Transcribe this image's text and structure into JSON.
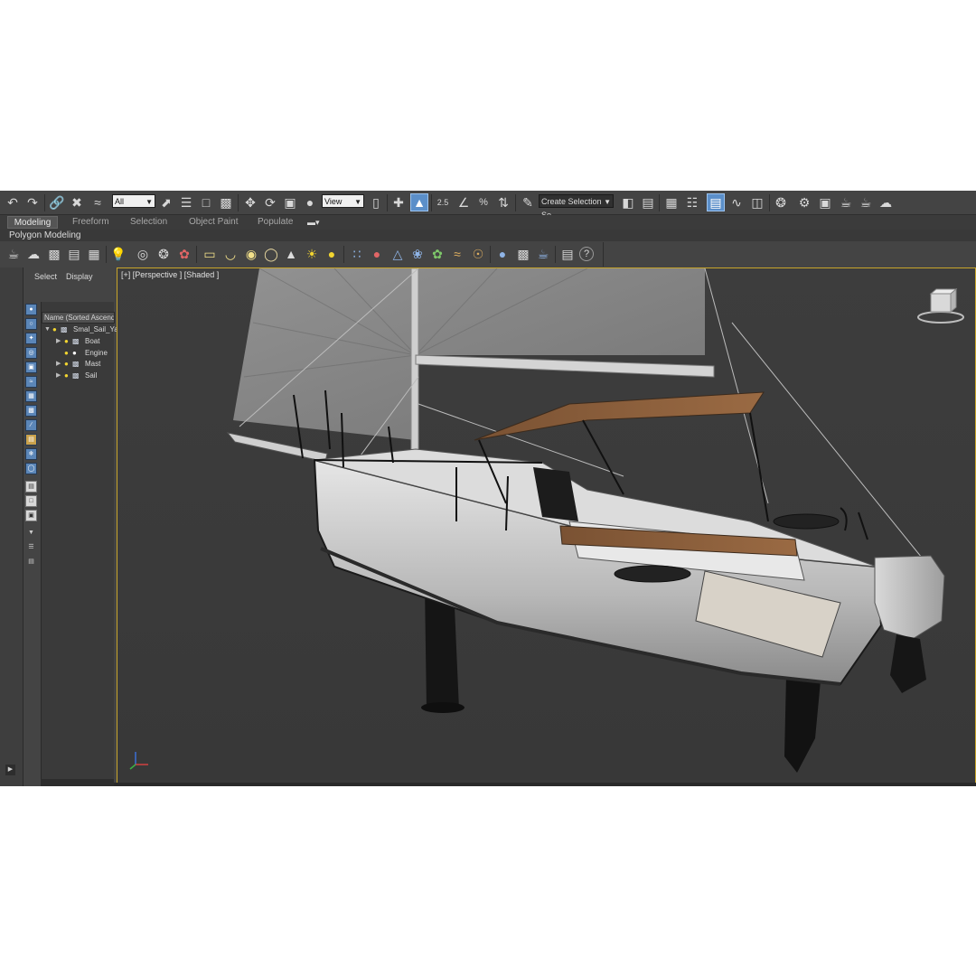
{
  "toolbar": {
    "selection_filter": "All",
    "reference_coord": "View",
    "snap_angle_label": "2.5",
    "named_selection_placeholder": "Create Selection Se"
  },
  "ribbon": {
    "tabs": [
      {
        "label": "Modeling"
      },
      {
        "label": "Freeform"
      },
      {
        "label": "Selection"
      },
      {
        "label": "Object Paint"
      },
      {
        "label": "Populate"
      }
    ],
    "panel_label": "Polygon Modeling"
  },
  "explorer": {
    "tabs": [
      {
        "label": "Select"
      },
      {
        "label": "Display"
      }
    ],
    "column_header": "Name (Sorted Ascending)",
    "items": [
      {
        "label": "Smal_Sail_Yacht"
      },
      {
        "label": "Boat"
      },
      {
        "label": "Engine"
      },
      {
        "label": "Mast"
      },
      {
        "label": "Sail"
      }
    ]
  },
  "viewport": {
    "label": "[+] [Perspective ] [Shaded ]",
    "active_border_color": "#c8a52a",
    "background_color": "#3c3c3c"
  },
  "icons": {
    "main_toolbar": [
      "undo-icon",
      "redo-icon",
      "link-icon",
      "unlink-icon",
      "bind-space-warp-icon",
      "select-object-icon",
      "select-by-name-icon",
      "rectangular-selection-icon",
      "window-crossing-icon",
      "move-icon",
      "rotate-icon",
      "scale-icon",
      "place-icon",
      "use-pivot-icon",
      "select-manipulate-icon",
      "keyboard-shortcut-override-icon",
      "snaps-toggle-icon",
      "angle-snap-icon",
      "percent-snap-icon",
      "spinner-snap-icon",
      "edit-named-selection-icon",
      "mirror-icon",
      "align-icon",
      "scene-explorer-icon",
      "layer-explorer-icon",
      "ribbon-toggle-icon",
      "curve-editor-icon",
      "schematic-view-icon",
      "material-editor-icon",
      "render-setup-icon",
      "rendered-frame-window-icon",
      "render-production-icon",
      "render-iterative-icon",
      "render-cloud-icon"
    ],
    "command_toolbar": [
      "teapot-icon",
      "cloud-icon",
      "texture-icon",
      "display-icon",
      "utilities-icon",
      "light-icon",
      "camera-icon",
      "helpers-icon",
      "spacewarp-icon",
      "box-icon",
      "hemisphere-icon",
      "sphere-icon",
      "torus-icon",
      "cone-icon",
      "sun-icon",
      "disc-icon",
      "particles-icon",
      "dynamics-icon",
      "cloth-icon",
      "nodes-icon",
      "foliage-icon",
      "hair-icon",
      "fur-icon",
      "material-ball-icon",
      "render-to-texture-icon",
      "render-icon",
      "viewport-config-icon",
      "help-icon"
    ]
  }
}
